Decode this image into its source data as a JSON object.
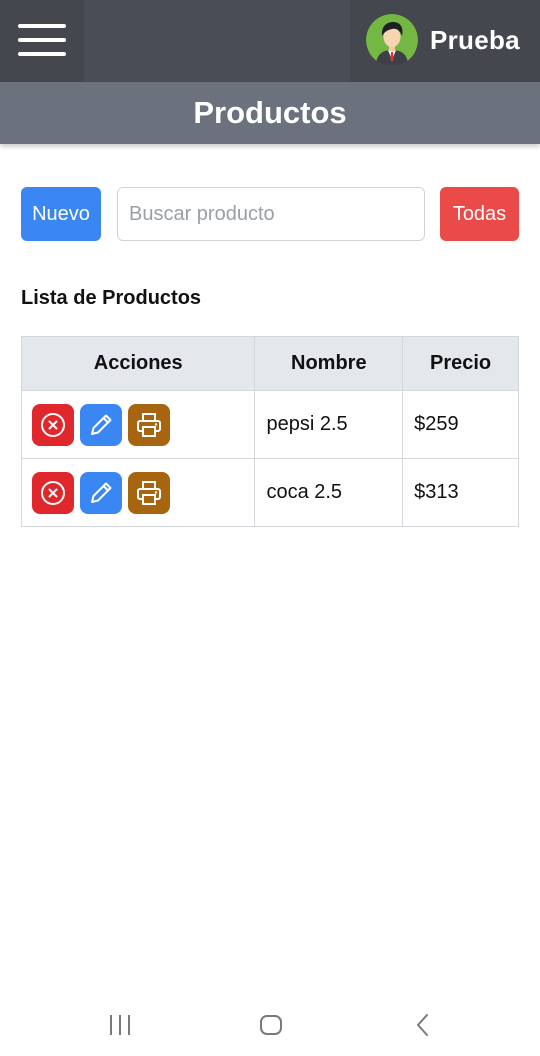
{
  "header": {
    "user_name": "Prueba",
    "title": "Productos"
  },
  "toolbar": {
    "new_label": "Nuevo",
    "search_placeholder": "Buscar producto",
    "search_value": "",
    "all_label": "Todas"
  },
  "list": {
    "title": "Lista de Productos",
    "columns": [
      "Acciones",
      "Nombre",
      "Precio"
    ],
    "rows": [
      {
        "name": "pepsi 2.5",
        "price": "$259"
      },
      {
        "name": "coca 2.5",
        "price": "$313"
      }
    ]
  },
  "icons": {
    "menu": "hamburger-menu-icon",
    "delete": "close-circle-icon",
    "edit": "pencil-icon",
    "print": "printer-icon",
    "nav_recent": "recent-apps-icon",
    "nav_home": "home-icon",
    "nav_back": "back-icon"
  },
  "colors": {
    "topbar": "#4a4d55",
    "titlebar": "#6b727d",
    "primary": "#3a86f2",
    "danger": "#ea4a48",
    "delete_action": "#e0272c",
    "print_action": "#a8650f",
    "table_header": "#e4e7ec"
  }
}
